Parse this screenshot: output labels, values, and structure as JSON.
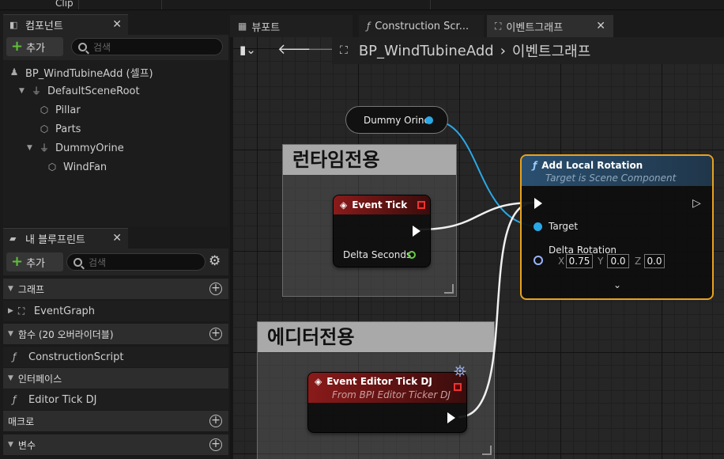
{
  "top_tabs": {
    "label": "Clip"
  },
  "components_panel": {
    "tab_label": "컴포넌트",
    "add_label": "추가",
    "search_placeholder": "검색",
    "tree": [
      {
        "label": "BP_WindTubineAdd (셀프)",
        "icon": "actor-icon"
      },
      {
        "label": "DefaultSceneRoot",
        "icon": "scene-root-icon"
      },
      {
        "label": "Pillar",
        "icon": "mesh-icon"
      },
      {
        "label": "Parts",
        "icon": "mesh-icon"
      },
      {
        "label": "DummyOrine",
        "icon": "scene-root-icon"
      },
      {
        "label": "WindFan",
        "icon": "mesh-icon"
      }
    ]
  },
  "blueprint_panel": {
    "tab_label": "내 블루프린트",
    "add_label": "추가",
    "search_placeholder": "검색",
    "sections": {
      "graphs": "그래프",
      "event_graph": "EventGraph",
      "functions": "함수 (20 오버라이더블)",
      "construction_script": "ConstructionScript",
      "interfaces": "인터페이스",
      "editor_tick": "Editor Tick DJ",
      "macros": "매크로",
      "variables": "변수"
    }
  },
  "graph_tabs": [
    {
      "label": "뷰포트",
      "icon": "viewport-icon"
    },
    {
      "label": "Construction Scr...",
      "icon": "function-icon"
    },
    {
      "label": "이벤트그래프",
      "icon": "event-graph-icon"
    }
  ],
  "breadcrumb": {
    "blueprint": "BP_WindTubineAdd",
    "graph": "이벤트그래프"
  },
  "comments": {
    "runtime": "런타임전용",
    "editor": "에디터전용"
  },
  "nodes": {
    "dummy_var": "Dummy Orine",
    "event_tick": {
      "title": "Event Tick",
      "delta": "Delta Seconds"
    },
    "editor_tick": {
      "title": "Event Editor Tick DJ",
      "sub": "From BPI Editor Ticker DJ"
    },
    "add_rotation": {
      "title": "Add Local Rotation",
      "sub": "Target is Scene Component",
      "target": "Target",
      "delta_rotation": "Delta Rotation",
      "x_label": "X",
      "x": "0.75",
      "y_label": "Y",
      "y": "0.0",
      "z_label": "Z",
      "z": "0.0"
    }
  },
  "colors": {
    "accent_orange": "#e8a21e",
    "pin_blue": "#2aa8e6",
    "event_red": "#8a1a1a",
    "add_green": "#5fbf3a"
  }
}
